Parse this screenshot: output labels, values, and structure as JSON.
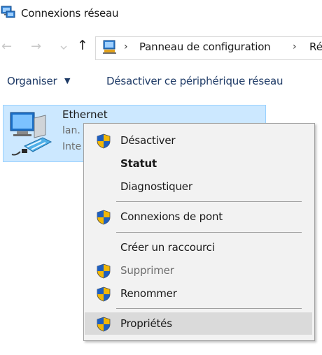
{
  "window": {
    "title": "Connexions réseau",
    "icon": "network-connections-icon"
  },
  "nav": {
    "back": "←",
    "forward": "→",
    "dropdown": "⌄",
    "up": "↑"
  },
  "address": {
    "separator": "›",
    "crumbs": [
      "Panneau de configuration",
      "Ré"
    ]
  },
  "commandbar": {
    "organise_label": "Organiser",
    "organise_caret": "▼",
    "disable_label": "Désactiver ce périphérique réseau"
  },
  "adapter": {
    "name": "Ethernet",
    "line2": "lan.",
    "line3": "Inte",
    "icon": "ethernet-adapter-icon"
  },
  "context_menu": {
    "items": [
      {
        "label": "Désactiver",
        "shield": true
      },
      {
        "label": "Statut",
        "bold": true
      },
      {
        "label": "Diagnostiquer"
      },
      {
        "label": "Connexions de pont",
        "shield": true
      },
      {
        "label": "Créer un raccourci"
      },
      {
        "label": "Supprimer",
        "shield": true,
        "disabled": true
      },
      {
        "label": "Renommer",
        "shield": true
      },
      {
        "label": "Propriétés",
        "shield": true,
        "highlighted": true
      }
    ]
  },
  "colors": {
    "selection_bg": "#cce8ff",
    "selection_border": "#99d1ff",
    "menu_bg": "#f2f2f2",
    "menu_hover": "#dadada",
    "command_text": "#1e3a66",
    "shield_blue": "#1f5fbf",
    "shield_yellow": "#f2b705"
  }
}
